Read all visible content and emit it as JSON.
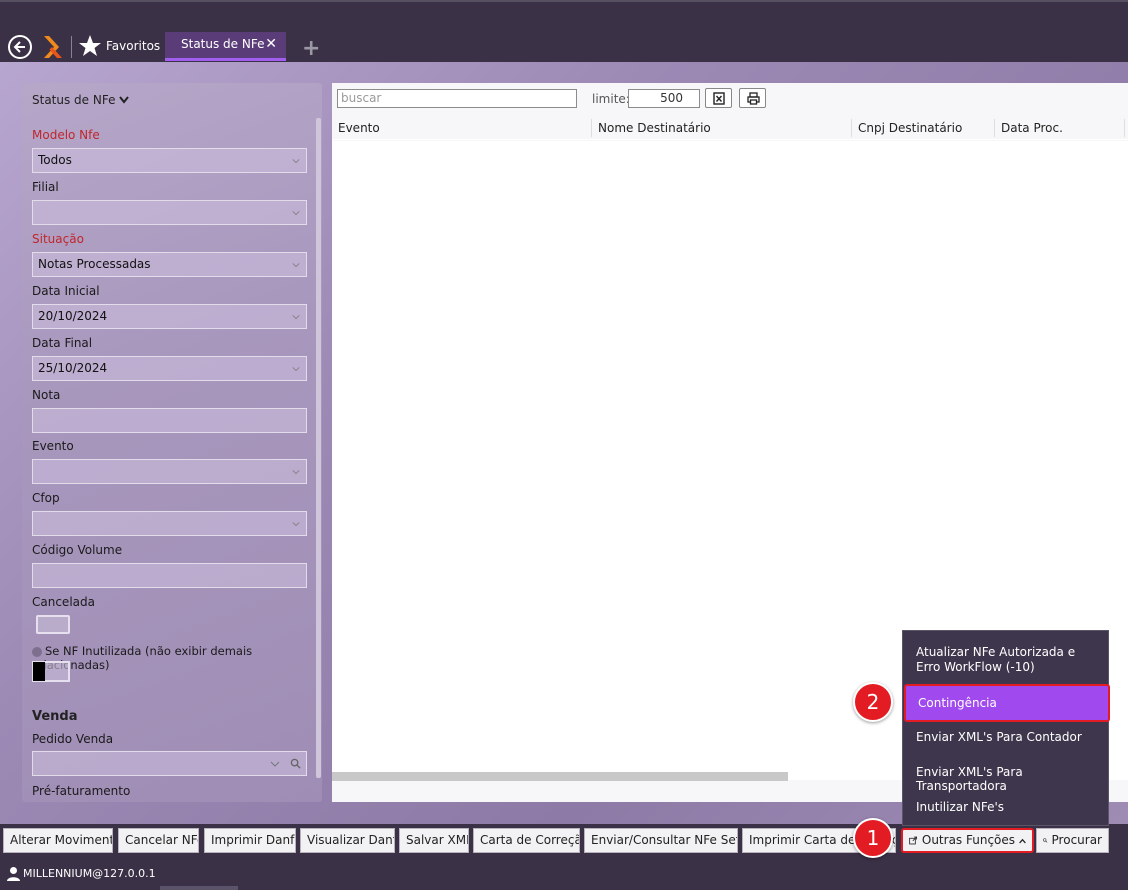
{
  "topbar": {
    "favorites_label": "Favoritos",
    "active_tab": "Status de NFe",
    "tab_close": "✕",
    "tab_add": "+"
  },
  "filters": {
    "title": "Status de NFe",
    "modelo_label": "Modelo Nfe",
    "modelo_value": "Todos",
    "filial_label": "Filial",
    "filial_value": "",
    "situacao_label": "Situação",
    "situacao_value": "Notas Processadas",
    "data_inicial_label": "Data Inicial",
    "data_inicial_value": "20/10/2024",
    "data_final_label": "Data Final",
    "data_final_value": "25/10/2024",
    "nota_label": "Nota",
    "nota_value": "",
    "evento_label": "Evento",
    "evento_value": "",
    "cfop_label": "Cfop",
    "cfop_value": "",
    "codigo_volume_label": "Código Volume",
    "codigo_volume_value": "",
    "cancelada_label": "Cancelada",
    "inutilizada_label": "Se NF Inutilizada (não exibir demais relacionadas)",
    "venda_section": "Venda",
    "pedido_venda_label": "Pedido Venda",
    "pre_faturamento_label": "Pré-faturamento"
  },
  "grid": {
    "search_placeholder": "buscar",
    "limit_label": "limite:",
    "limit_value": "500",
    "columns": [
      "Evento",
      "Nome Destinatário",
      "Cnpj Destinatário",
      "Data Proc."
    ]
  },
  "toolbar": {
    "buttons": [
      "Alterar Movimento",
      "Cancelar NFe",
      "Imprimir Danfe",
      "Visualizar Danfe",
      "Salvar XML",
      "Carta de Correção",
      "Enviar/Consultar NFe Sefaz",
      "Imprimir Carta de Correção"
    ],
    "outras_label": "Outras Funções",
    "procurar_label": "Procurar"
  },
  "menu": {
    "items": [
      "Atualizar NFe Autorizada e Erro WorkFlow (-10)",
      "Contingência",
      "Enviar XML's Para Contador",
      "Enviar XML's Para Transportadora",
      "Inutilizar NFe's"
    ]
  },
  "annotations": {
    "badge1": "1",
    "badge2": "2"
  },
  "status": {
    "user": "MILLENNIUM@127.0.0.1"
  },
  "colors": {
    "accent": "#a049ef",
    "highlight_border": "#e31c24",
    "chrome": "#3b3147"
  }
}
